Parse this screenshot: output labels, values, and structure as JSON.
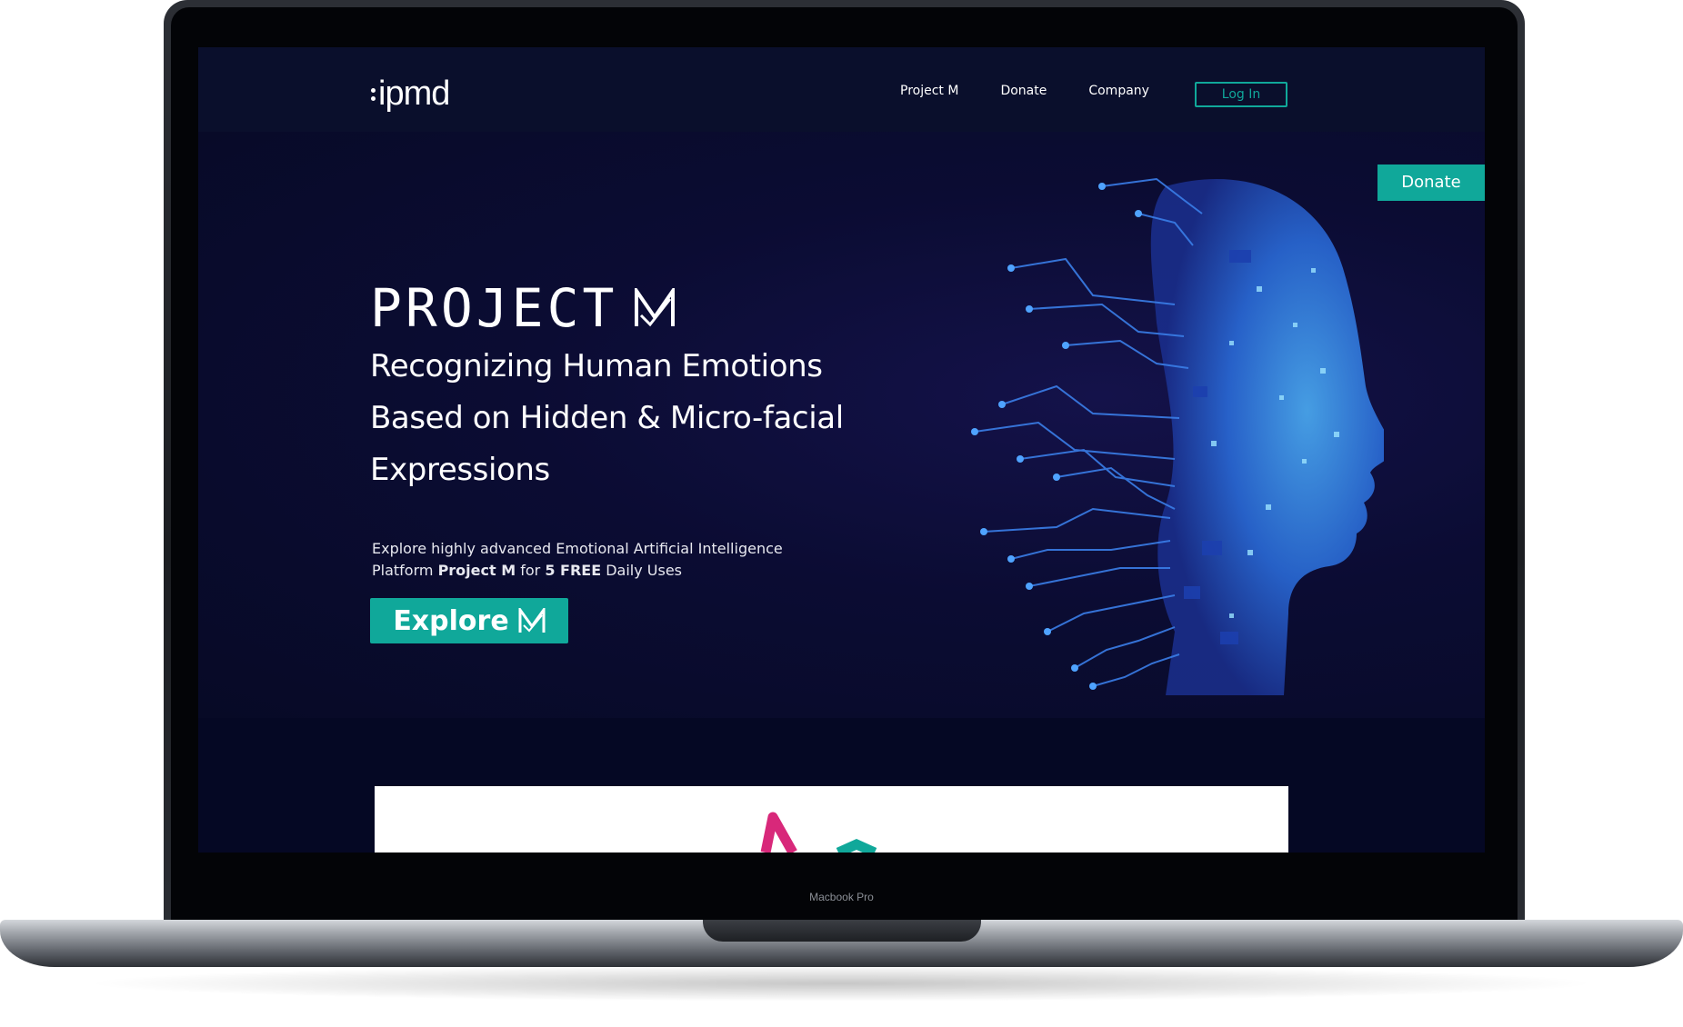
{
  "device": {
    "model_label": "Macbook Pro"
  },
  "navbar": {
    "logo_text": "ipmd",
    "links": [
      "Project M",
      "Donate",
      "Company"
    ],
    "login_label": "Log In"
  },
  "hero": {
    "donate_tab_label": "Donate",
    "title": "PROJECT",
    "headline_lines": [
      "Recognizing Human Emotions",
      "Based on Hidden & Micro-facial",
      "Expressions"
    ],
    "description_line1": "Explore highly advanced Emotional Artificial Intelligence",
    "description_line2_parts": [
      "Platform ",
      "Project M",
      " for ",
      "5 FREE",
      " Daily Uses"
    ],
    "explore_label": "Explore"
  },
  "icons": {
    "m_logo": "m-logo-icon",
    "head_art": "digital-head-icon"
  },
  "colors": {
    "accent": "#10a89a",
    "background": "#060a26",
    "navbar": "#0a0f2c",
    "head_blue": "#2f7ff2"
  }
}
